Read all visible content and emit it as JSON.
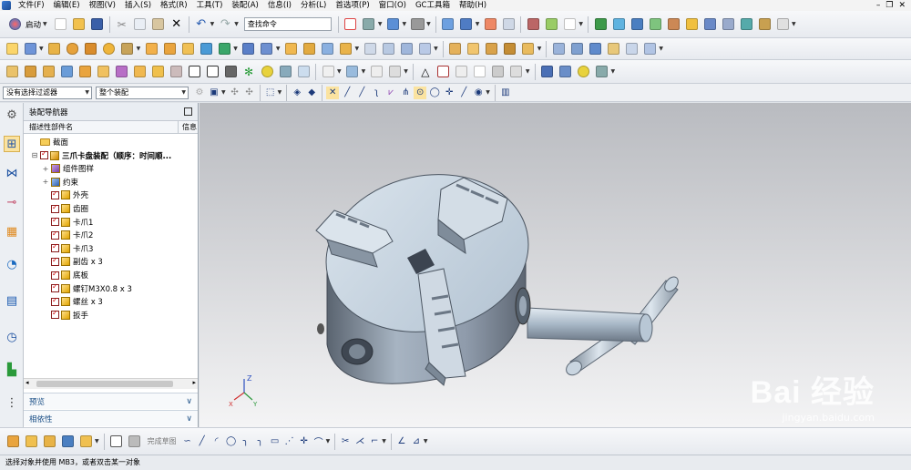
{
  "menu": {
    "items": [
      "文件(F)",
      "编辑(E)",
      "视图(V)",
      "插入(S)",
      "格式(R)",
      "工具(T)",
      "装配(A)",
      "信息(I)",
      "分析(L)",
      "首选项(P)",
      "窗口(O)",
      "GC工具箱",
      "帮助(H)"
    ],
    "window_controls": [
      "–",
      "❐",
      "✕"
    ]
  },
  "toolbar": {
    "start_label": "启动",
    "command_finder_placeholder": "查找命令"
  },
  "filter_bar": {
    "selection_filter": "没有选择过滤器",
    "scope": "整个装配"
  },
  "navigator": {
    "title": "装配导航器",
    "columns": [
      "描述性部件名",
      "信息"
    ],
    "sections": [
      {
        "label": "截面",
        "type": "folder",
        "indent": 0
      },
      {
        "label": "三爪卡盘装配（顺序：时间顺...",
        "type": "assembly",
        "indent": 0,
        "bold": true,
        "expander": "⊟"
      },
      {
        "label": "组件图样",
        "type": "drawing",
        "indent": 1,
        "expander": "+"
      },
      {
        "label": "约束",
        "type": "constraint",
        "indent": 1,
        "expander": "+"
      },
      {
        "label": "外壳",
        "type": "part",
        "indent": 1
      },
      {
        "label": "齿圈",
        "type": "part",
        "indent": 1
      },
      {
        "label": "卡爪1",
        "type": "part",
        "indent": 1
      },
      {
        "label": "卡爪2",
        "type": "part",
        "indent": 1
      },
      {
        "label": "卡爪3",
        "type": "part",
        "indent": 1
      },
      {
        "label": "副齿 x 3",
        "type": "part",
        "indent": 1
      },
      {
        "label": "底板",
        "type": "part",
        "indent": 1
      },
      {
        "label": "螺钉M3X0.8 x 3",
        "type": "part",
        "indent": 1
      },
      {
        "label": "螺丝 x 3",
        "type": "part",
        "indent": 1
      },
      {
        "label": "扳手",
        "type": "part",
        "indent": 1
      }
    ],
    "panels": [
      "预览",
      "相依性"
    ]
  },
  "sketch_toolbar": {
    "finish_label": "完成草图"
  },
  "viewport": {
    "watermark_brand": "Bai 经验",
    "watermark_url": "jingyan.baidu.com",
    "triad_z": "Z",
    "triad_x": "X",
    "triad_y": "Y"
  },
  "status": {
    "text": "选择对象并使用 MB3，或者双击某一对象"
  },
  "colors": {
    "accent": "#1b4f86",
    "part_steel": "#aebfcd",
    "part_dark": "#5c6470",
    "check_red": "#cc0000"
  }
}
